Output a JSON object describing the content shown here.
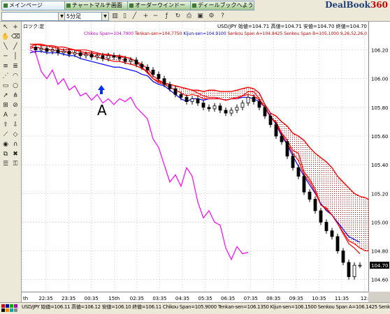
{
  "app": {
    "logo_main": "DealBook",
    "logo_num": "360"
  },
  "tabs": [
    {
      "label": "メインページ",
      "active": true
    },
    {
      "label": "チャートマルチ画面",
      "active": false
    },
    {
      "label": "オーダーウインドー",
      "active": false
    },
    {
      "label": "ディールブックへようこそ",
      "active": false
    }
  ],
  "toolbar": {
    "timeframe": "5分足"
  },
  "left_toolbar": {
    "lock_label": "ロツク:定"
  },
  "chart_header": {
    "symbol_line": "USD/JPY 始値=104.71 高値=104.71 安値=104.70 終値=104.70",
    "indicator_parts": [
      {
        "text": "Chikou Span=104.7900",
        "color": "#cc00cc"
      },
      {
        "text": "Tenkan-sen=104.7750",
        "color": "#cc0000"
      },
      {
        "text": "Kijun-sen=104.9100",
        "color": "#0000cc"
      },
      {
        "text": "Senkou Span A=104.8425",
        "color": "#cc0000"
      },
      {
        "text": "Senkou Span B=105.1000",
        "color": "#cc0000"
      },
      {
        "text": "9,26,52,26,0",
        "color": "#cc0000"
      }
    ]
  },
  "annotation": {
    "label": "A"
  },
  "status_bar": {
    "text": "USD/JPY 始値=106.11 高値=106.12 安値=106.10 終値=106.11  Chikou Span=105.9000 Tenkan-sen=106.1350 Kijun-sen=106.1500 Senkou Span A=106.1425 Senkou Span"
  },
  "colors": {
    "tenkan": "#ff0000",
    "kijun": "#0000ff",
    "chikou": "#ff00ff",
    "cloud": "#cc0000",
    "candle": "#000000"
  },
  "chart_data": {
    "type": "line",
    "title": "",
    "xlabel": "",
    "ylabel": "",
    "ylim": [
      104.55,
      106.3
    ],
    "x_ticks": [
      "th",
      "22:35",
      "23:35",
      "00:35",
      "15th",
      "02:35",
      "03:35",
      "04:35",
      "05:35",
      "06:35",
      "07:35",
      "08:35",
      "09:35",
      "10:35",
      "11:35",
      "12:"
    ],
    "y_ticks": [
      106.2,
      106.0,
      105.8,
      105.6,
      105.4,
      105.2,
      105.0,
      104.8,
      104.6
    ],
    "last_price_label": "104.70",
    "price": [
      106.22,
      106.2,
      106.21,
      106.19,
      106.2,
      106.18,
      106.19,
      106.17,
      106.18,
      106.16,
      106.17,
      106.15,
      106.16,
      106.14,
      106.16,
      106.15,
      106.14,
      106.12,
      106.13,
      106.1,
      106.08,
      106.06,
      106.03,
      106.0,
      105.96,
      105.93,
      105.89,
      105.87,
      105.84,
      105.86,
      105.83,
      105.8,
      105.79,
      105.81,
      105.78,
      105.76,
      105.78,
      105.8,
      105.83,
      105.87,
      105.84,
      105.8,
      105.74,
      105.68,
      105.6,
      105.56,
      105.46,
      105.38,
      105.32,
      105.21,
      105.16,
      105.08,
      105.0,
      104.94,
      104.9,
      104.8,
      104.72,
      104.62,
      104.7,
      104.7
    ],
    "series": [
      {
        "name": "Tenkan-sen",
        "color": "#ff0000",
        "values": [
          106.24,
          106.24,
          106.23,
          106.23,
          106.22,
          106.21,
          106.2,
          106.2,
          106.2,
          106.2,
          106.2,
          106.19,
          106.18,
          106.17,
          106.17,
          106.16,
          106.15,
          106.15,
          106.14,
          106.12,
          106.1,
          106.07,
          106.02,
          105.99,
          105.97,
          105.96,
          105.95,
          105.94,
          105.93,
          105.92,
          105.9,
          105.88,
          105.87,
          105.87,
          105.86,
          105.85,
          105.86,
          105.87,
          105.88,
          105.91,
          105.91,
          105.86,
          105.8,
          105.73,
          105.7,
          105.62,
          105.57,
          105.5,
          105.48,
          105.35,
          105.3,
          105.23,
          105.12,
          105.1,
          105.05,
          104.99,
          104.92,
          104.85,
          104.82,
          104.78
        ]
      },
      {
        "name": "Kijun-sen",
        "color": "#0000ff",
        "values": [
          106.18,
          106.19,
          106.19,
          106.18,
          106.18,
          106.18,
          106.17,
          106.16,
          106.16,
          106.14,
          106.13,
          106.12,
          106.11,
          106.1,
          106.09,
          106.08,
          106.08,
          106.07,
          106.06,
          106.05,
          106.03,
          106.02,
          105.98,
          105.96,
          105.95,
          105.92,
          105.89,
          105.86,
          105.84,
          105.86,
          105.86,
          105.85,
          105.86,
          105.86,
          105.86,
          105.85,
          105.86,
          105.86,
          105.87,
          105.87,
          105.86,
          105.84,
          105.8,
          105.74,
          105.68,
          105.6,
          105.54,
          105.46,
          105.39,
          105.32,
          105.26,
          105.2,
          105.13,
          105.08,
          105.05,
          105.0,
          104.95,
          104.9,
          104.88,
          104.86
        ]
      },
      {
        "name": "Chikou Span",
        "color": "#ff00ff",
        "values": [
          106.2,
          106.18,
          106.05,
          106.0,
          106.06,
          105.96,
          106.0,
          105.92,
          105.95,
          105.88,
          105.9,
          105.85,
          105.89,
          105.83,
          105.86,
          105.82,
          105.86,
          105.84,
          105.87,
          105.8,
          105.76,
          105.72,
          105.58,
          105.52,
          105.4,
          105.28,
          105.33,
          105.25,
          105.38,
          105.32,
          105.14,
          105.03,
          105.08,
          105.0,
          104.98,
          104.82,
          104.74,
          104.83,
          104.78,
          104.79
        ]
      },
      {
        "name": "Senkou Span A",
        "color": "#ff0000",
        "values": [
          106.21,
          106.22,
          106.21,
          106.2,
          106.2,
          106.19,
          106.19,
          106.18,
          106.18,
          106.17,
          106.17,
          106.16,
          106.15,
          106.14,
          106.13,
          106.12,
          106.12,
          106.11,
          106.1,
          106.09,
          106.07,
          106.05,
          106.0,
          105.97,
          105.96,
          105.94,
          105.92,
          105.9,
          105.88,
          105.89,
          105.88,
          105.86,
          105.86,
          105.86,
          105.86,
          105.85,
          105.86,
          105.86,
          105.88,
          105.89,
          105.88,
          105.85,
          105.8,
          105.73,
          105.69,
          105.61,
          105.55,
          105.48,
          105.43,
          105.33,
          105.28,
          105.21,
          105.12,
          105.09,
          105.05,
          104.99,
          104.93,
          104.87,
          104.85,
          104.82,
          104.8,
          104.8,
          104.8,
          104.8,
          104.8,
          104.8
        ]
      },
      {
        "name": "Senkou Span B",
        "color": "#ff0000",
        "values": [
          106.22,
          106.24,
          106.24,
          106.23,
          106.23,
          106.22,
          106.22,
          106.21,
          106.2,
          106.19,
          106.18,
          106.18,
          106.17,
          106.17,
          106.16,
          106.16,
          106.16,
          106.15,
          106.14,
          106.12,
          106.08,
          106.04,
          106.0,
          105.98,
          105.97,
          105.96,
          105.95,
          105.94,
          105.93,
          105.92,
          105.92,
          105.91,
          105.92,
          105.92,
          105.91,
          105.91,
          105.91,
          105.92,
          105.93,
          105.94,
          105.93,
          105.9,
          105.82,
          105.76,
          105.74,
          105.7,
          105.67,
          105.62,
          105.6,
          105.57,
          105.52,
          105.48,
          105.45,
          105.42,
          105.38,
          105.32,
          105.28,
          105.24,
          105.2,
          105.18,
          105.17,
          105.15,
          105.12,
          105.1,
          105.1,
          105.1
        ]
      }
    ]
  }
}
